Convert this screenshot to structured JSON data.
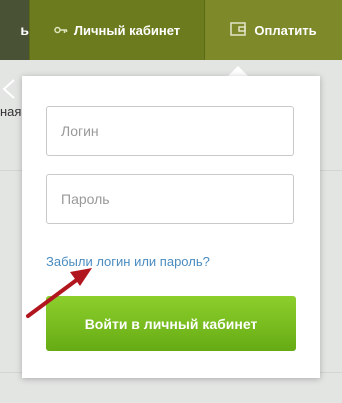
{
  "nav": {
    "left_text": "ь",
    "cabinet_label": "Личный кабинет",
    "pay_label": "Оплатить",
    "key_icon": "key-icon",
    "wallet_icon": "wallet-icon"
  },
  "background": {
    "close_icon": "close-icon",
    "text": "ная"
  },
  "login_form": {
    "login_placeholder": "Логин",
    "password_placeholder": "Пароль",
    "forgot_link": "Забыли логин или пароль?",
    "submit_label": "Войти в личный кабинет"
  },
  "colors": {
    "accent_green": "#7cbf22",
    "nav_green": "#6b7b1e",
    "link_blue": "#4a8cc0",
    "annotation_red": "#b1161e"
  }
}
